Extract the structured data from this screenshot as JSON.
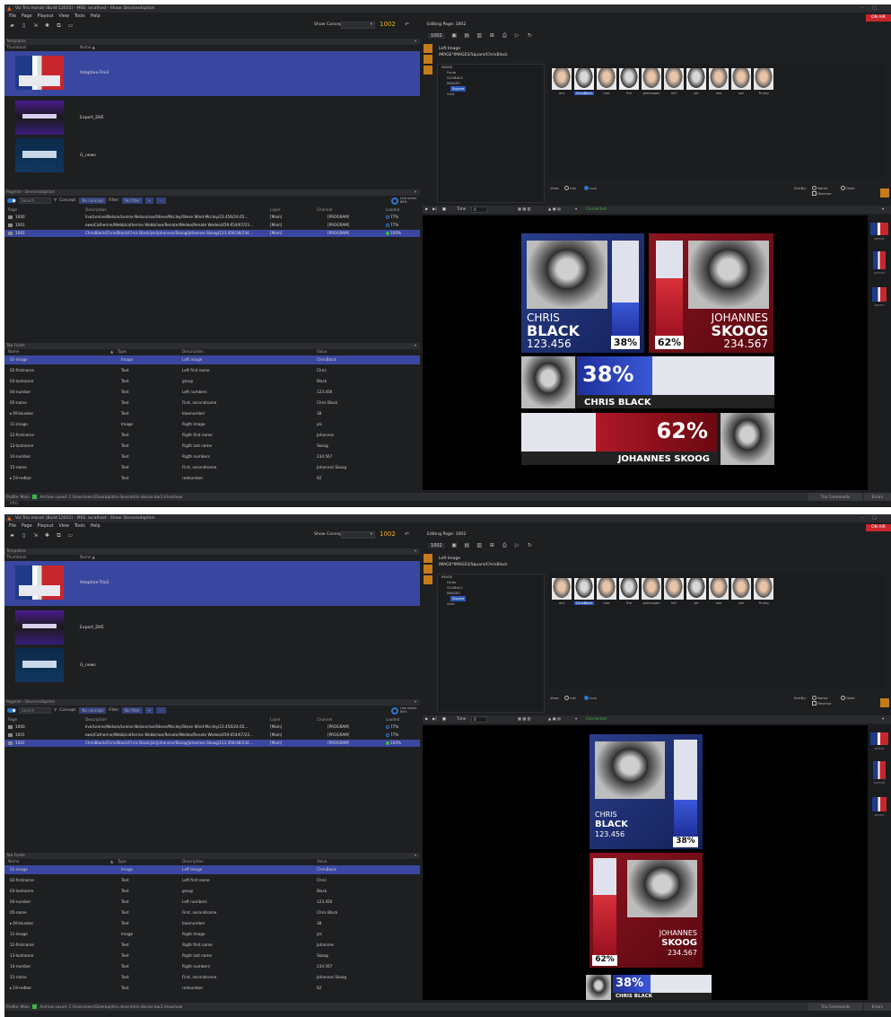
{
  "window_title": "Viz Trio maruti (Build 12031) - MSE: localhost - Show: Devicesdaption",
  "on_air": "ON AIR",
  "menu": [
    "File",
    "Page",
    "Playout",
    "View",
    "Tools",
    "Help"
  ],
  "toolbar": {
    "show_concept_label": "Show Concept:",
    "page_number": "1002"
  },
  "templates": {
    "title": "Templates",
    "col_thumbnail": "Thumbnail",
    "col_name": "Name ▲",
    "items": [
      {
        "name": "Adaptive-Trio2"
      },
      {
        "name": "Export_DVE"
      },
      {
        "name": "G_news"
      }
    ]
  },
  "pagelist": {
    "title": "Pagelist - Devicesdaption",
    "search_placeholder": "Search",
    "concept_label": "Concept:",
    "concept_value": "No concept",
    "filter_label": "Filter:",
    "filter_value": "No filter",
    "online_label": "Live online",
    "online_pct": "84%",
    "columns": [
      "Page",
      "Description",
      "Layer",
      "Channel",
      "Loaded"
    ],
    "rows": [
      {
        "page": "1000",
        "description": "live/Lenine/Nelson/Lenine Nelson/sse/Steve/Mccley/Steve Wind-Mccley/23.456/24.65...",
        "layer": "[Main]",
        "channel": "[PROGRAM]",
        "loaded": "77%"
      },
      {
        "page": "1001",
        "description": "owe/Catherine/Webb/catherine Webb/rwe/Renate/Wedea/Renate Wedea/459.654/67/23...",
        "layer": "[Main]",
        "channel": "[PROGRAM]",
        "loaded": "77%"
      },
      {
        "page": "1002",
        "description": "ChrisBlack/Chris/Black/Chris Black/jsk/Johannes/Skoog/Johannes Skoog/123.456/38/234...",
        "layer": "[Main]",
        "channel": "[PROGRAM]",
        "loaded": "100%"
      }
    ]
  },
  "tabfields": {
    "title": "Tab Fields",
    "columns": [
      "Name",
      "Type",
      "Description",
      "Value"
    ],
    "rows": [
      {
        "name": "01-image",
        "type": "Image",
        "description": "Left Image",
        "value": "ChrisBlack"
      },
      {
        "name": "02-firstname",
        "type": "Text",
        "description": "Left first name",
        "value": "Chris"
      },
      {
        "name": "03-lastname",
        "type": "Text",
        "description": "group",
        "value": "Black"
      },
      {
        "name": "04-number",
        "type": "Text",
        "description": "Left numbers",
        "value": "123.456"
      },
      {
        "name": "05-name",
        "type": "Text",
        "description": "First, secondname",
        "value": "Chris Black"
      },
      {
        "name": "▸ 09-bluebar",
        "type": "Text",
        "description": "bluenumber",
        "value": "38"
      },
      {
        "name": "11-image",
        "type": "Image",
        "description": "Rigth Image",
        "value": "jsk"
      },
      {
        "name": "12-firstname",
        "type": "Text",
        "description": "Rigth first name",
        "value": "Johannes"
      },
      {
        "name": "13-lastname",
        "type": "Text",
        "description": "Rigth last name",
        "value": "Skoog"
      },
      {
        "name": "14-number",
        "type": "Text",
        "description": "Rigth numbers",
        "value": "234.567"
      },
      {
        "name": "15-name",
        "type": "Text",
        "description": "First, secondname",
        "value": "Johannes Skoog"
      },
      {
        "name": "▸ 19-redbar",
        "type": "Text",
        "description": "rednumber",
        "value": "62"
      }
    ]
  },
  "status": {
    "profile": "Profile: Main",
    "archive": "Archive saved: C:\\Users\\sesc\\Desktop\\trio device\\trio device bar2.triosshow",
    "trio_commands": "Trio Commands",
    "errors": "Errors",
    "prg": "PRG"
  },
  "editor": {
    "editing_title": "Editing Page: 1002",
    "page": "1002",
    "field_name": "Left Image",
    "field_path": "IMAGE*IMAGES/Square/ChrisBlack",
    "tree": [
      "IMAGE",
      "Fonts",
      "GLOBALS",
      "IMAGES",
      "Square",
      "Vizrt"
    ],
    "faces": [
      "ant",
      "ChrisBlack",
      "cwe",
      "fhe",
      "greenspan",
      "hil1",
      "jsk",
      "rwe",
      "swi",
      "Trump"
    ],
    "view_label": "View:",
    "view_list": "List",
    "view_icon": "Icon",
    "sortby_label": "SortBy:",
    "sort_name": "Name",
    "sort_date": "Date",
    "reverse": "Reverse",
    "time_label": "Time",
    "time_value": "0",
    "connected": "Connected",
    "rightstrip": [
      "default",
      "portrait",
      "square"
    ]
  },
  "graphic": {
    "left_first": "CHRIS",
    "left_last": "BLACK",
    "left_number": "123.456",
    "left_pct": "38%",
    "right_first": "JOHANNES",
    "right_last": "SKOOG",
    "right_number": "234.567",
    "right_pct": "62%",
    "left_fullname": "CHRIS BLACK",
    "right_fullname": "JOHANNES SKOOG",
    "left_value": 38,
    "right_value": 62
  }
}
